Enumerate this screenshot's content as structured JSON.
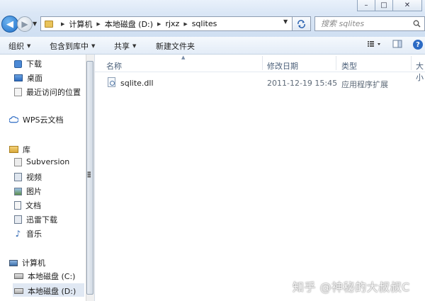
{
  "window": {
    "minimize": "–",
    "maximize": "□",
    "close": "✕"
  },
  "address": {
    "crumbs": [
      "计算机",
      "本地磁盘 (D:)",
      "rjxz",
      "sqlites"
    ],
    "search_placeholder": "搜索 sqlites"
  },
  "toolbar": {
    "organize": "组织",
    "include_in_library": "包含到库中",
    "share": "共享",
    "new_folder": "新建文件夹",
    "help": "?"
  },
  "nav": {
    "quick": [
      "下载",
      "桌面",
      "最近访问的位置"
    ],
    "wps": "WPS云文档",
    "library": "库",
    "library_items": [
      "Subversion",
      "视频",
      "图片",
      "文档",
      "迅雷下载",
      "音乐"
    ],
    "computer": "计算机",
    "drives": [
      "本地磁盘 (C:)",
      "本地磁盘 (D:)"
    ]
  },
  "columns": {
    "name": "名称",
    "modified": "修改日期",
    "type": "类型",
    "size": "大小"
  },
  "files": [
    {
      "name": "sqlite.dll",
      "modified": "2011-12-19 15:45",
      "type": "应用程序扩展"
    }
  ],
  "watermark": "知乎 @神秘的大叔叔C",
  "colors": {
    "selection": "#e0e8f3",
    "header_text": "#4c607a",
    "address_bar_bg": "#dbe7f6"
  }
}
